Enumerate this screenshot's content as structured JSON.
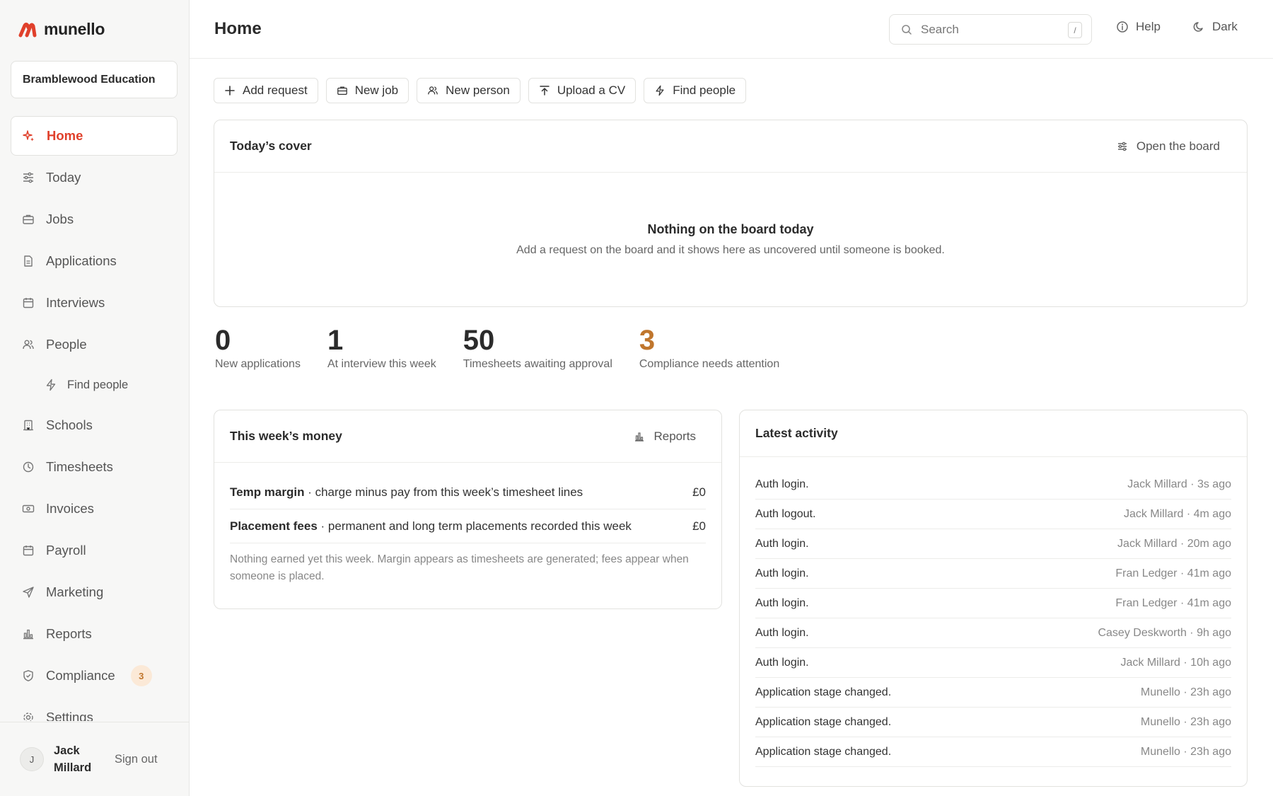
{
  "brand": {
    "name": "munello",
    "color": "#e0402b"
  },
  "org": {
    "name": "Bramblewood Education"
  },
  "nav": [
    {
      "label": "Home",
      "icon": "sparkle-icon",
      "active": true
    },
    {
      "label": "Today",
      "icon": "sliders-icon"
    },
    {
      "label": "Jobs",
      "icon": "briefcase-icon"
    },
    {
      "label": "Applications",
      "icon": "document-icon"
    },
    {
      "label": "Interviews",
      "icon": "calendar-icon"
    },
    {
      "label": "People",
      "icon": "people-icon"
    },
    {
      "label": "Find people",
      "icon": "bolt-icon",
      "sub": true
    },
    {
      "label": "Schools",
      "icon": "building-icon"
    },
    {
      "label": "Timesheets",
      "icon": "clock-icon"
    },
    {
      "label": "Invoices",
      "icon": "banknote-icon"
    },
    {
      "label": "Payroll",
      "icon": "calendar-icon"
    },
    {
      "label": "Marketing",
      "icon": "send-icon"
    },
    {
      "label": "Reports",
      "icon": "bar-chart-icon"
    },
    {
      "label": "Compliance",
      "icon": "shield-icon",
      "badge": "3"
    },
    {
      "label": "Settings",
      "icon": "gear-icon"
    }
  ],
  "user": {
    "initial": "J",
    "name": "Jack Millard",
    "signout": "Sign out"
  },
  "header": {
    "title": "Home",
    "search_placeholder": "Search",
    "search_shortcut": "/",
    "help": "Help",
    "dark": "Dark"
  },
  "actions": [
    {
      "label": "Add request",
      "icon": "plus-icon"
    },
    {
      "label": "New job",
      "icon": "briefcase-icon"
    },
    {
      "label": "New person",
      "icon": "people-icon"
    },
    {
      "label": "Upload a CV",
      "icon": "upload-icon"
    },
    {
      "label": "Find people",
      "icon": "bolt-icon"
    }
  ],
  "cover": {
    "title": "Today’s cover",
    "link": "Open the board",
    "empty_title": "Nothing on the board today",
    "empty_sub": "Add a request on the board and it shows here as uncovered until someone is booked."
  },
  "stats": [
    {
      "value": "0",
      "label": "New applications",
      "color": "#2b2b2b"
    },
    {
      "value": "1",
      "label": "At interview this week",
      "color": "#2b2b2b"
    },
    {
      "value": "50",
      "label": "Timesheets awaiting approval",
      "color": "#2b2b2b"
    },
    {
      "value": "3",
      "label": "Compliance needs attention",
      "color": "#c0762d"
    }
  ],
  "money": {
    "title": "This week’s money",
    "link": "Reports",
    "rows": [
      {
        "name": "Temp margin",
        "desc": " · charge minus pay from this week’s timesheet lines",
        "amount": "£0"
      },
      {
        "name": "Placement fees",
        "desc": " · permanent and long term placements recorded this week",
        "amount": "£0"
      }
    ],
    "note": "Nothing earned yet this week. Margin appears as timesheets are generated; fees appear when someone is placed."
  },
  "activity": {
    "title": "Latest activity",
    "rows": [
      {
        "what": "Auth login.",
        "who": "Jack Millard · 3s ago"
      },
      {
        "what": "Auth logout.",
        "who": "Jack Millard · 4m ago"
      },
      {
        "what": "Auth login.",
        "who": "Jack Millard · 20m ago"
      },
      {
        "what": "Auth login.",
        "who": "Fran Ledger · 41m ago"
      },
      {
        "what": "Auth login.",
        "who": "Fran Ledger · 41m ago"
      },
      {
        "what": "Auth login.",
        "who": "Casey Deskworth · 9h ago"
      },
      {
        "what": "Auth login.",
        "who": "Jack Millard · 10h ago"
      },
      {
        "what": "Application stage changed.",
        "who": "Munello · 23h ago"
      },
      {
        "what": "Application stage changed.",
        "who": "Munello · 23h ago"
      },
      {
        "what": "Application stage changed.",
        "who": "Munello · 23h ago"
      }
    ]
  }
}
